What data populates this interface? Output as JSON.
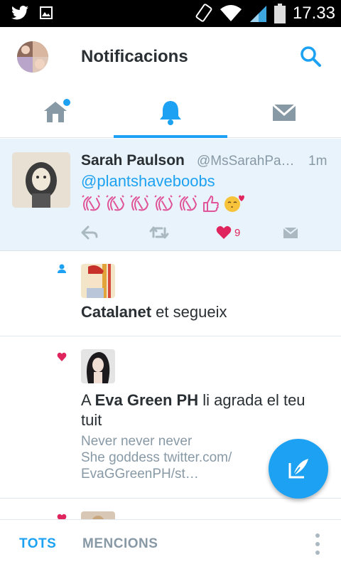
{
  "status_bar": {
    "time": "17.33",
    "left_icons": [
      "twitter-bird-icon",
      "image-icon"
    ],
    "right_icons": [
      "screen-rotate-icon",
      "wifi-icon",
      "signal-icon",
      "battery-icon"
    ]
  },
  "header": {
    "title": "Notificacions",
    "avatar": "profile-avatar",
    "search_icon": "search-icon"
  },
  "tabs": [
    {
      "name": "home",
      "icon": "home-icon",
      "has_dot": true,
      "active": false
    },
    {
      "name": "notifications",
      "icon": "bell-icon",
      "active": true
    },
    {
      "name": "messages",
      "icon": "envelope-icon",
      "active": false
    }
  ],
  "tweet": {
    "author_name": "Sarah Paulson",
    "author_handle": "@MsSarahPa…",
    "time": "1m",
    "mention": "@plantshaveboobs",
    "emojis": [
      "clapping-hands",
      "clapping-hands",
      "clapping-hands",
      "clapping-hands",
      "clapping-hands",
      "thumbs-up",
      "kissing-face"
    ],
    "like_count": "9",
    "actions": [
      "reply-icon",
      "retweet-icon",
      "heart-icon",
      "dm-icon"
    ]
  },
  "notifications": [
    {
      "type": "follow",
      "icon": "person-icon",
      "user": "Catalanet",
      "action": "et segueix"
    },
    {
      "type": "like",
      "icon": "heart-icon",
      "prefix": "A ",
      "user": "Eva Green PH",
      "action": "li agrada el teu tuit",
      "quote_lines": [
        "Never never never",
        "She goddess twitter.com/",
        "EvaGGreenPH/st…"
      ]
    },
    {
      "type": "like",
      "icon": "heart-icon"
    }
  ],
  "fab": {
    "icon": "compose-tweet-icon"
  },
  "bottom_tabs": {
    "all": "TOTS",
    "mentions": "MENCIONS",
    "overflow_icon": "overflow-menu-icon"
  },
  "colors": {
    "accent": "#1da1f2",
    "like": "#e0245e",
    "muted": "#8899a6",
    "tweet_bg": "#e9f3fb"
  }
}
